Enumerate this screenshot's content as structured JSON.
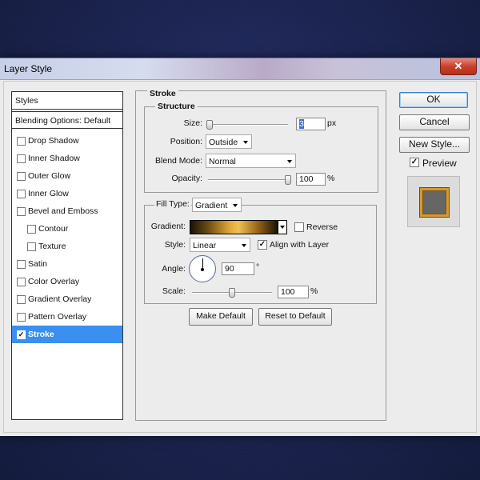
{
  "window": {
    "title": "Layer Style",
    "close_glyph": "✕"
  },
  "style_list": {
    "header": "Styles",
    "blending": "Blending Options: Default",
    "items": [
      {
        "label": "Drop Shadow",
        "checked": false,
        "indent": false
      },
      {
        "label": "Inner Shadow",
        "checked": false,
        "indent": false
      },
      {
        "label": "Outer Glow",
        "checked": false,
        "indent": false
      },
      {
        "label": "Inner Glow",
        "checked": false,
        "indent": false
      },
      {
        "label": "Bevel and Emboss",
        "checked": false,
        "indent": false
      },
      {
        "label": "Contour",
        "checked": false,
        "indent": true
      },
      {
        "label": "Texture",
        "checked": false,
        "indent": true
      },
      {
        "label": "Satin",
        "checked": false,
        "indent": false
      },
      {
        "label": "Color Overlay",
        "checked": false,
        "indent": false
      },
      {
        "label": "Gradient Overlay",
        "checked": false,
        "indent": false
      },
      {
        "label": "Pattern Overlay",
        "checked": false,
        "indent": false
      },
      {
        "label": "Stroke",
        "checked": true,
        "indent": false,
        "selected": true
      }
    ],
    "check_glyph": "✓"
  },
  "stroke": {
    "title": "Stroke",
    "structure": {
      "title": "Structure",
      "size_label": "Size:",
      "size_value": "3",
      "size_unit": "px",
      "size_slider_fraction": 0.02,
      "position_label": "Position:",
      "position_value": "Outside",
      "blend_label": "Blend Mode:",
      "blend_value": "Normal",
      "opacity_label": "Opacity:",
      "opacity_value": "100",
      "opacity_unit": "%",
      "opacity_slider_fraction": 1.0
    },
    "fill": {
      "type_label": "Fill Type:",
      "type_value": "Gradient",
      "gradient_label": "Gradient:",
      "reverse_label": "Reverse",
      "reverse_checked": false,
      "style_label": "Style:",
      "style_value": "Linear",
      "align_label": "Align with Layer",
      "align_checked": true,
      "angle_label": "Angle:",
      "angle_value": "90",
      "angle_unit": "°",
      "scale_label": "Scale:",
      "scale_value": "100",
      "scale_unit": "%",
      "scale_slider_fraction": 0.5
    }
  },
  "buttons": {
    "make_default": "Make Default",
    "reset_default": "Reset to Default",
    "ok": "OK",
    "cancel": "Cancel",
    "new_style": "New Style...",
    "preview_label": "Preview",
    "preview_checked": true
  }
}
